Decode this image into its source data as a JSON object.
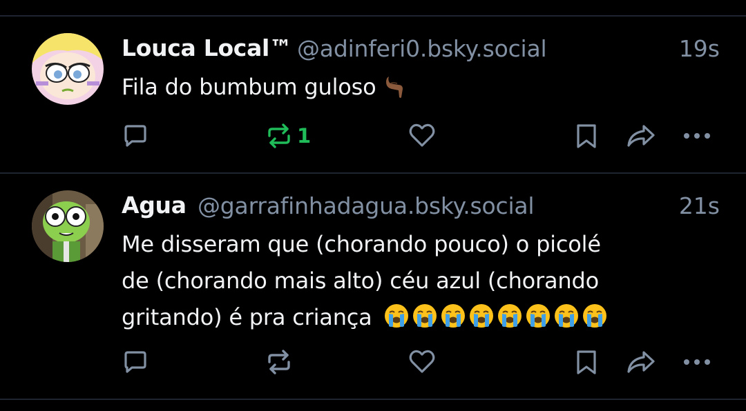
{
  "colors": {
    "background": "#000000",
    "divider": "#1e2530",
    "text": "#f1f3f5",
    "muted": "#8290a4",
    "repost_active": "#20bc5a"
  },
  "posts": [
    {
      "author": "Louca Local™",
      "handle": "@adinferi0.bsky.social",
      "time": "19s",
      "text": "Fila do bumbum guloso",
      "emoji": "backhand-index-pointing-down",
      "repost_count": "1",
      "repost_active": true
    },
    {
      "author": "Agua",
      "handle": "@garrafinhadagua.bsky.social",
      "time": "21s",
      "text_lines": [
        "Me disseram que (chorando pouco) o picolé",
        "de (chorando mais alto) céu azul (chorando",
        "gritando) é pra criança"
      ],
      "emoji": "loudly-crying-face",
      "emoji_count": 8,
      "repost_count": "",
      "repost_active": false
    }
  ]
}
